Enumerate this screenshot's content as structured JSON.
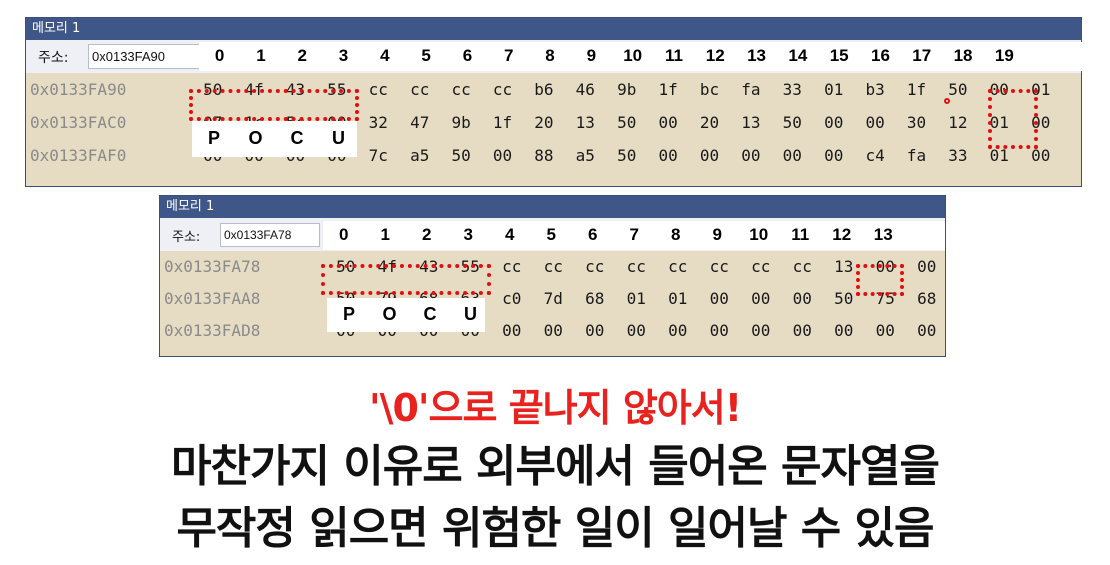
{
  "window1": {
    "title": "메모리 1",
    "address_label": "주소:",
    "address_value": "0x0133FA90",
    "columns": [
      "0",
      "1",
      "2",
      "3",
      "4",
      "5",
      "6",
      "7",
      "8",
      "9",
      "10",
      "11",
      "12",
      "13",
      "14",
      "15",
      "16",
      "17",
      "18",
      "19"
    ],
    "rows": [
      {
        "addr": "0x0133FA90",
        "bytes": [
          "50",
          "4f",
          "43",
          "55",
          "cc",
          "cc",
          "cc",
          "cc",
          "b6",
          "46",
          "9b",
          "1f",
          "bc",
          "fa",
          "33",
          "01",
          "b3",
          "1f",
          "50",
          "00",
          "01"
        ]
      },
      {
        "addr": "0x0133FAC0",
        "bytes": [
          "07",
          "1c",
          "5c",
          "00",
          "32",
          "47",
          "9b",
          "1f",
          "20",
          "13",
          "50",
          "00",
          "20",
          "13",
          "50",
          "00",
          "00",
          "30",
          "12",
          "01",
          "00"
        ]
      },
      {
        "addr": "0x0133FAF0",
        "bytes": [
          "00",
          "00",
          "00",
          "00",
          "7c",
          "a5",
          "50",
          "00",
          "88",
          "a5",
          "50",
          "00",
          "00",
          "00",
          "00",
          "00",
          "c4",
          "fa",
          "33",
          "01",
          "00"
        ]
      }
    ],
    "chip_letters": [
      "P",
      "O",
      "C",
      "U"
    ]
  },
  "window2": {
    "title": "메모리 1",
    "address_label": "주소:",
    "address_value": "0x0133FA78",
    "columns": [
      "0",
      "1",
      "2",
      "3",
      "4",
      "5",
      "6",
      "7",
      "8",
      "9",
      "10",
      "11",
      "12",
      "13"
    ],
    "rows": [
      {
        "addr": "0x0133FA78",
        "bytes": [
          "50",
          "4f",
          "43",
          "55",
          "cc",
          "cc",
          "cc",
          "cc",
          "cc",
          "cc",
          "cc",
          "cc",
          "13",
          "00",
          "00"
        ]
      },
      {
        "addr": "0x0133FAA8",
        "bytes": [
          "50",
          "79",
          "68",
          "63",
          "c0",
          "7d",
          "68",
          "01",
          "01",
          "00",
          "00",
          "00",
          "50",
          "75",
          "68"
        ]
      },
      {
        "addr": "0x0133FAD8",
        "bytes": [
          "00",
          "00",
          "00",
          "00",
          "00",
          "00",
          "00",
          "00",
          "00",
          "00",
          "00",
          "00",
          "00",
          "00",
          "00"
        ]
      }
    ],
    "chip_letters": [
      "P",
      "O",
      "C",
      "U"
    ]
  },
  "caption": {
    "line1": "'\\0'으로 끝나지 않아서!",
    "line2": "마찬가지 이유로 외부에서 들어온 문자열을",
    "line3": "무작정 읽으면 위험한 일이 일어날 수 있음"
  },
  "colors": {
    "title_bar": "#3f5689",
    "memory_bg": "#e6dcc4",
    "highlight_red": "#e01010",
    "caption_red": "#e8231f"
  }
}
